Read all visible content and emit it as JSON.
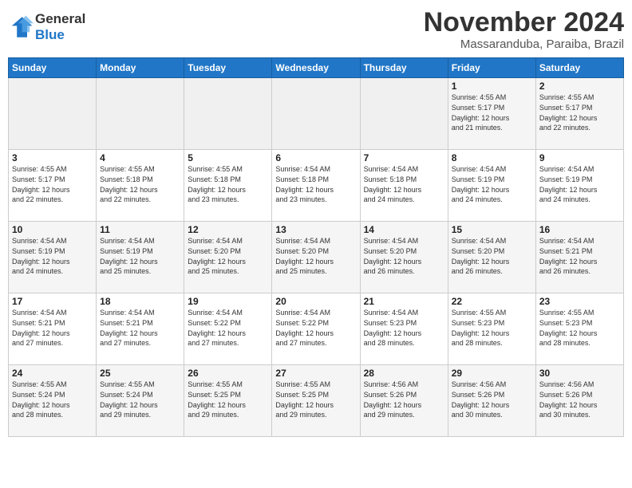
{
  "header": {
    "logo_line1": "General",
    "logo_line2": "Blue",
    "month": "November 2024",
    "location": "Massaranduba, Paraiba, Brazil"
  },
  "weekdays": [
    "Sunday",
    "Monday",
    "Tuesday",
    "Wednesday",
    "Thursday",
    "Friday",
    "Saturday"
  ],
  "weeks": [
    [
      {
        "day": "",
        "info": ""
      },
      {
        "day": "",
        "info": ""
      },
      {
        "day": "",
        "info": ""
      },
      {
        "day": "",
        "info": ""
      },
      {
        "day": "",
        "info": ""
      },
      {
        "day": "1",
        "info": "Sunrise: 4:55 AM\nSunset: 5:17 PM\nDaylight: 12 hours\nand 21 minutes."
      },
      {
        "day": "2",
        "info": "Sunrise: 4:55 AM\nSunset: 5:17 PM\nDaylight: 12 hours\nand 22 minutes."
      }
    ],
    [
      {
        "day": "3",
        "info": "Sunrise: 4:55 AM\nSunset: 5:17 PM\nDaylight: 12 hours\nand 22 minutes."
      },
      {
        "day": "4",
        "info": "Sunrise: 4:55 AM\nSunset: 5:18 PM\nDaylight: 12 hours\nand 22 minutes."
      },
      {
        "day": "5",
        "info": "Sunrise: 4:55 AM\nSunset: 5:18 PM\nDaylight: 12 hours\nand 23 minutes."
      },
      {
        "day": "6",
        "info": "Sunrise: 4:54 AM\nSunset: 5:18 PM\nDaylight: 12 hours\nand 23 minutes."
      },
      {
        "day": "7",
        "info": "Sunrise: 4:54 AM\nSunset: 5:18 PM\nDaylight: 12 hours\nand 24 minutes."
      },
      {
        "day": "8",
        "info": "Sunrise: 4:54 AM\nSunset: 5:19 PM\nDaylight: 12 hours\nand 24 minutes."
      },
      {
        "day": "9",
        "info": "Sunrise: 4:54 AM\nSunset: 5:19 PM\nDaylight: 12 hours\nand 24 minutes."
      }
    ],
    [
      {
        "day": "10",
        "info": "Sunrise: 4:54 AM\nSunset: 5:19 PM\nDaylight: 12 hours\nand 24 minutes."
      },
      {
        "day": "11",
        "info": "Sunrise: 4:54 AM\nSunset: 5:19 PM\nDaylight: 12 hours\nand 25 minutes."
      },
      {
        "day": "12",
        "info": "Sunrise: 4:54 AM\nSunset: 5:20 PM\nDaylight: 12 hours\nand 25 minutes."
      },
      {
        "day": "13",
        "info": "Sunrise: 4:54 AM\nSunset: 5:20 PM\nDaylight: 12 hours\nand 25 minutes."
      },
      {
        "day": "14",
        "info": "Sunrise: 4:54 AM\nSunset: 5:20 PM\nDaylight: 12 hours\nand 26 minutes."
      },
      {
        "day": "15",
        "info": "Sunrise: 4:54 AM\nSunset: 5:20 PM\nDaylight: 12 hours\nand 26 minutes."
      },
      {
        "day": "16",
        "info": "Sunrise: 4:54 AM\nSunset: 5:21 PM\nDaylight: 12 hours\nand 26 minutes."
      }
    ],
    [
      {
        "day": "17",
        "info": "Sunrise: 4:54 AM\nSunset: 5:21 PM\nDaylight: 12 hours\nand 27 minutes."
      },
      {
        "day": "18",
        "info": "Sunrise: 4:54 AM\nSunset: 5:21 PM\nDaylight: 12 hours\nand 27 minutes."
      },
      {
        "day": "19",
        "info": "Sunrise: 4:54 AM\nSunset: 5:22 PM\nDaylight: 12 hours\nand 27 minutes."
      },
      {
        "day": "20",
        "info": "Sunrise: 4:54 AM\nSunset: 5:22 PM\nDaylight: 12 hours\nand 27 minutes."
      },
      {
        "day": "21",
        "info": "Sunrise: 4:54 AM\nSunset: 5:23 PM\nDaylight: 12 hours\nand 28 minutes."
      },
      {
        "day": "22",
        "info": "Sunrise: 4:55 AM\nSunset: 5:23 PM\nDaylight: 12 hours\nand 28 minutes."
      },
      {
        "day": "23",
        "info": "Sunrise: 4:55 AM\nSunset: 5:23 PM\nDaylight: 12 hours\nand 28 minutes."
      }
    ],
    [
      {
        "day": "24",
        "info": "Sunrise: 4:55 AM\nSunset: 5:24 PM\nDaylight: 12 hours\nand 28 minutes."
      },
      {
        "day": "25",
        "info": "Sunrise: 4:55 AM\nSunset: 5:24 PM\nDaylight: 12 hours\nand 29 minutes."
      },
      {
        "day": "26",
        "info": "Sunrise: 4:55 AM\nSunset: 5:25 PM\nDaylight: 12 hours\nand 29 minutes."
      },
      {
        "day": "27",
        "info": "Sunrise: 4:55 AM\nSunset: 5:25 PM\nDaylight: 12 hours\nand 29 minutes."
      },
      {
        "day": "28",
        "info": "Sunrise: 4:56 AM\nSunset: 5:26 PM\nDaylight: 12 hours\nand 29 minutes."
      },
      {
        "day": "29",
        "info": "Sunrise: 4:56 AM\nSunset: 5:26 PM\nDaylight: 12 hours\nand 30 minutes."
      },
      {
        "day": "30",
        "info": "Sunrise: 4:56 AM\nSunset: 5:26 PM\nDaylight: 12 hours\nand 30 minutes."
      }
    ]
  ]
}
